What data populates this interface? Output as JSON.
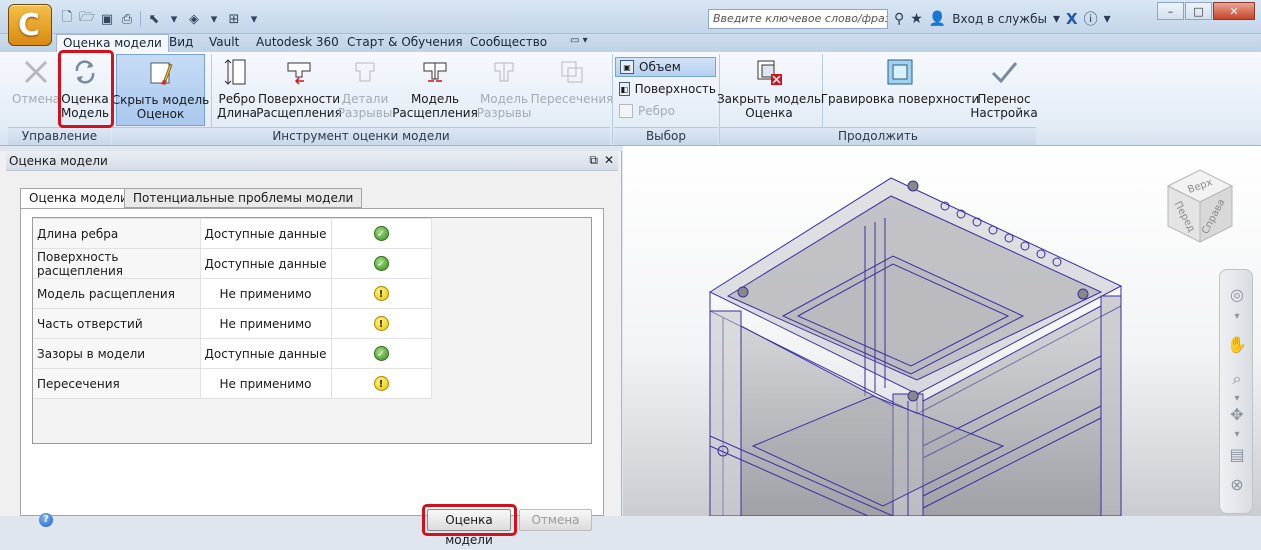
{
  "app": {
    "icon_letter": "C"
  },
  "search": {
    "placeholder": "Введите ключевое слово/фразу"
  },
  "account": {
    "signin_label": "Вход в службы"
  },
  "window": {
    "minimize": "–",
    "maximize": "□",
    "close": "✕"
  },
  "tabs": [
    "Оценка модели",
    "Вид",
    "Vault",
    "Autodesk 360",
    "Старт & Обучения",
    "Сообщество"
  ],
  "ribbon": {
    "cancel": "Отмена",
    "eval_line1": "Оценка",
    "eval_line2": "Модель",
    "hide_line1": "Скрыть модель",
    "hide_line2": "Оценок",
    "edge_line1": "Ребро",
    "edge_line2": "Длина",
    "surf_line1": "Поверхности",
    "surf_line2": "Расщепления",
    "details_line1": "Детали",
    "details_line2": "Разрывы",
    "model_line1": "Модель",
    "model_line2": "Расщепления",
    "modelgaps_line1": "Модель",
    "modelgaps_line2": "Разрывы",
    "intersections": "Пересечения",
    "volume": "Объем",
    "surface": "Поверхность",
    "edge": "Ребро",
    "close_line1": "Закрыть модель",
    "close_line2": "Оценка",
    "engrave": "Гравировка поверхности",
    "transfer_line1": "Перенос",
    "transfer_line2": "Настройка",
    "panel_manage": "Управление",
    "panel_tool": "Инструмент оценки модели",
    "panel_select": "Выбор",
    "panel_continue": "Продолжить"
  },
  "dock": {
    "title": "Оценка модели",
    "tab_eval": "Оценка модели",
    "tab_issues": "Потенциальные проблемы модели",
    "rows": [
      {
        "name": "Длина ребра",
        "status": "Доступные данные",
        "icon": "ok"
      },
      {
        "name": "Поверхность расщепления",
        "status": "Доступные данные",
        "icon": "ok"
      },
      {
        "name": "Модель расщепления",
        "status": "Не применимо",
        "icon": "warn"
      },
      {
        "name": "Часть отверстий",
        "status": "Не применимо",
        "icon": "warn"
      },
      {
        "name": "Зазоры в модели",
        "status": "Доступные данные",
        "icon": "ok"
      },
      {
        "name": "Пересечения",
        "status": "Не применимо",
        "icon": "warn"
      }
    ],
    "eval_button": "Оценка модели",
    "cancel_button": "Отмена"
  },
  "viewcube": {
    "top": "Верх",
    "front": "Перед",
    "right": "Справа"
  },
  "colors": {
    "highlight": "#d4101c",
    "model_edges": "#3b2fa0"
  }
}
